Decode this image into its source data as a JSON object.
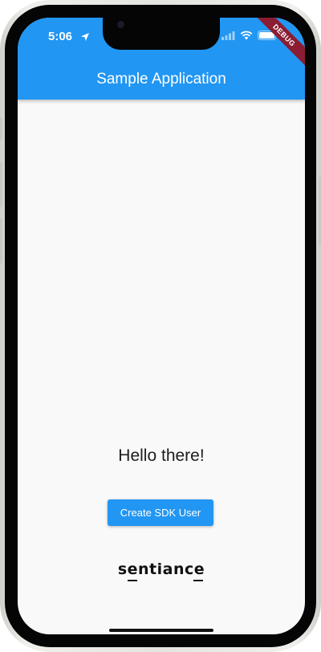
{
  "status_bar": {
    "time": "5:06",
    "debug_banner": "DEBUG"
  },
  "app_bar": {
    "title": "Sample Application",
    "color": "#2196f3"
  },
  "main": {
    "greeting": "Hello there!",
    "create_user_button_label": "Create SDK User"
  },
  "logo": {
    "text": "sentiance"
  },
  "icons": {
    "location": "location-arrow-icon",
    "signal": "signal-bars-icon",
    "wifi": "wifi-icon",
    "battery": "battery-icon"
  }
}
